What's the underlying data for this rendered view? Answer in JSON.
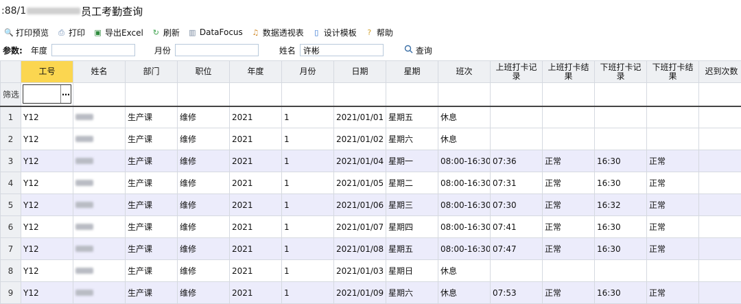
{
  "header": {
    "url_prefix": ":88/1",
    "title": "员工考勤查询"
  },
  "toolbar": [
    {
      "name": "print-preview",
      "label": "打印预览",
      "icon": "print-preview-icon",
      "glyph": "🔍"
    },
    {
      "name": "print",
      "label": "打印",
      "icon": "printer-icon",
      "glyph": "⎙"
    },
    {
      "name": "export-excel",
      "label": "导出Excel",
      "icon": "excel-icon",
      "glyph": "▣"
    },
    {
      "name": "refresh",
      "label": "刷新",
      "icon": "refresh-icon",
      "glyph": "↻"
    },
    {
      "name": "datafocus",
      "label": "DataFocus",
      "icon": "datafocus-icon",
      "glyph": "▥"
    },
    {
      "name": "pivot",
      "label": "数据透视表",
      "icon": "pivot-icon",
      "glyph": "♫"
    },
    {
      "name": "design-template",
      "label": "设计模板",
      "icon": "template-icon",
      "glyph": "▯"
    },
    {
      "name": "help",
      "label": "帮助",
      "icon": "help-icon",
      "glyph": "?"
    }
  ],
  "params": {
    "label": "参数:",
    "year_label": "年度",
    "year_value": "",
    "month_label": "月份",
    "month_value": "",
    "name_label": "姓名",
    "name_value": "许彬",
    "query_label": "查询"
  },
  "grid": {
    "columns": [
      "工号",
      "姓名",
      "部门",
      "职位",
      "年度",
      "月份",
      "日期",
      "星期",
      "班次",
      "上班打卡记录",
      "上班打卡结果",
      "下班打卡记录",
      "下班打卡结果",
      "迟到次数"
    ],
    "filter_label": "筛选",
    "rows": [
      {
        "n": "1",
        "id": "Y12",
        "dept": "生产课",
        "pos": "维修",
        "year": "2021",
        "month": "1",
        "date": "2021/01/01",
        "wd": "星期五",
        "shift": "休息",
        "in": "",
        "in_res": "",
        "out": "",
        "out_res": "",
        "late": ""
      },
      {
        "n": "2",
        "id": "Y12",
        "dept": "生产课",
        "pos": "维修",
        "year": "2021",
        "month": "1",
        "date": "2021/01/02",
        "wd": "星期六",
        "shift": "休息",
        "in": "",
        "in_res": "",
        "out": "",
        "out_res": "",
        "late": ""
      },
      {
        "n": "3",
        "id": "Y12",
        "dept": "生产课",
        "pos": "维修",
        "year": "2021",
        "month": "1",
        "date": "2021/01/04",
        "wd": "星期一",
        "shift": "08:00-16:30",
        "in": "07:36",
        "in_res": "正常",
        "out": "16:30",
        "out_res": "正常",
        "late": ""
      },
      {
        "n": "4",
        "id": "Y12",
        "dept": "生产课",
        "pos": "维修",
        "year": "2021",
        "month": "1",
        "date": "2021/01/05",
        "wd": "星期二",
        "shift": "08:00-16:30",
        "in": "07:31",
        "in_res": "正常",
        "out": "16:30",
        "out_res": "正常",
        "late": ""
      },
      {
        "n": "5",
        "id": "Y12",
        "dept": "生产课",
        "pos": "维修",
        "year": "2021",
        "month": "1",
        "date": "2021/01/06",
        "wd": "星期三",
        "shift": "08:00-16:30",
        "in": "07:30",
        "in_res": "正常",
        "out": "16:32",
        "out_res": "正常",
        "late": ""
      },
      {
        "n": "6",
        "id": "Y12",
        "dept": "生产课",
        "pos": "维修",
        "year": "2021",
        "month": "1",
        "date": "2021/01/07",
        "wd": "星期四",
        "shift": "08:00-16:30",
        "in": "07:41",
        "in_res": "正常",
        "out": "16:30",
        "out_res": "正常",
        "late": ""
      },
      {
        "n": "7",
        "id": "Y12",
        "dept": "生产课",
        "pos": "维修",
        "year": "2021",
        "month": "1",
        "date": "2021/01/08",
        "wd": "星期五",
        "shift": "08:00-16:30",
        "in": "07:47",
        "in_res": "正常",
        "out": "16:30",
        "out_res": "正常",
        "late": ""
      },
      {
        "n": "8",
        "id": "Y12",
        "dept": "生产课",
        "pos": "维修",
        "year": "2021",
        "month": "1",
        "date": "2021/01/03",
        "wd": "星期日",
        "shift": "休息",
        "in": "",
        "in_res": "",
        "out": "",
        "out_res": "",
        "late": ""
      },
      {
        "n": "9",
        "id": "Y12",
        "dept": "生产课",
        "pos": "维修",
        "year": "2021",
        "month": "1",
        "date": "2021/01/09",
        "wd": "星期六",
        "shift": "休息",
        "in": "07:53",
        "in_res": "正常",
        "out": "16:30",
        "out_res": "正常",
        "late": ""
      }
    ]
  }
}
